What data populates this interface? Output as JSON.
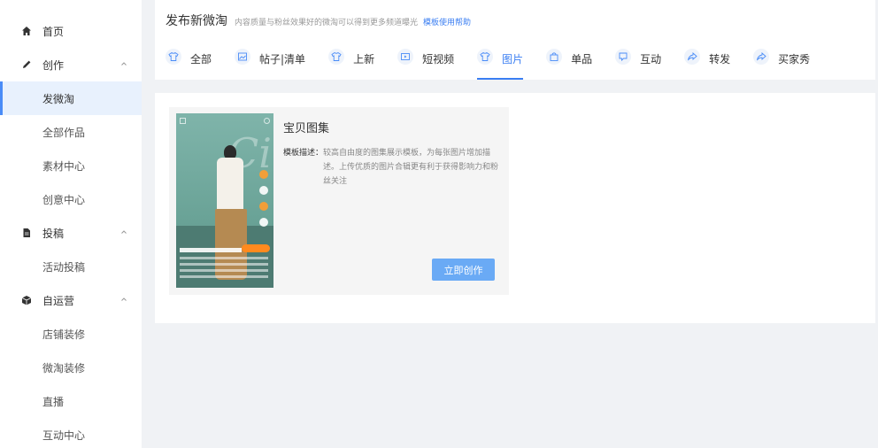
{
  "sidebar": {
    "home": "首页",
    "create": {
      "label": "创作",
      "items": [
        "发微淘",
        "全部作品",
        "素材中心",
        "创意中心"
      ]
    },
    "submit": {
      "label": "投稿",
      "items": [
        "活动投稿"
      ]
    },
    "selfop": {
      "label": "自运营",
      "items": [
        "店铺装修",
        "微淘装修",
        "直播",
        "互动中心"
      ]
    },
    "active_item": "发微淘"
  },
  "header": {
    "title": "发布新微淘",
    "desc": "内容质量与粉丝效果好的微淘可以得到更多频道曝光",
    "help_link": "模板使用帮助"
  },
  "tabs": [
    {
      "label": "全部",
      "icon": "shirt-icon"
    },
    {
      "label": "帖子|清单",
      "icon": "image-icon"
    },
    {
      "label": "上新",
      "icon": "shirt-icon"
    },
    {
      "label": "短视频",
      "icon": "video-icon"
    },
    {
      "label": "图片",
      "icon": "shirt-icon",
      "active": true
    },
    {
      "label": "单品",
      "icon": "bag-icon"
    },
    {
      "label": "互动",
      "icon": "chat-icon"
    },
    {
      "label": "转发",
      "icon": "share-icon"
    },
    {
      "label": "买家秀",
      "icon": "share-icon"
    }
  ],
  "template_card": {
    "title": "宝贝图集",
    "desc_label": "模板描述：",
    "desc_text": "较高自由度的图集展示模板，为每张图片增加描述。上传优质的图片合辑更有利于获得影响力和粉丝关注",
    "button": "立即创作"
  },
  "colors": {
    "accent": "#3a7ef2",
    "button": "#6aaaf5",
    "active_bg": "#e8f1fd"
  }
}
